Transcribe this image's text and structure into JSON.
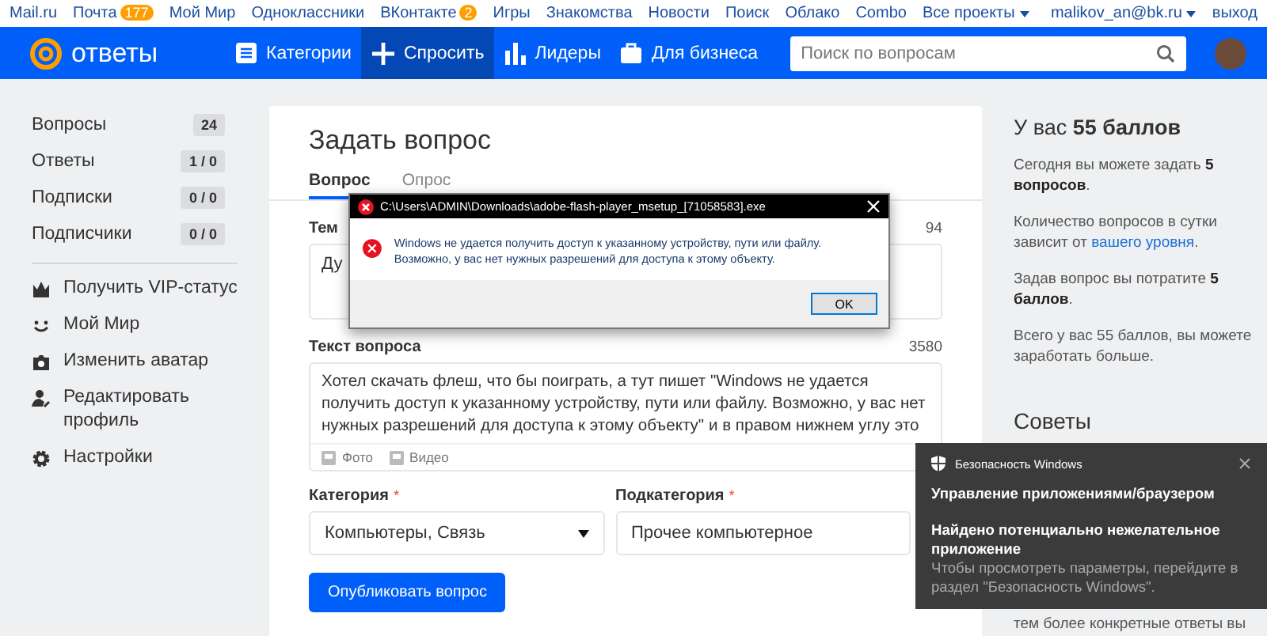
{
  "top_nav": {
    "items": [
      {
        "label": "Mail.ru"
      },
      {
        "label": "Почта",
        "badge": "177"
      },
      {
        "label": "Мой Мир"
      },
      {
        "label": "Одноклассники"
      },
      {
        "label": "ВКонтакте",
        "badge": "2"
      },
      {
        "label": "Игры"
      },
      {
        "label": "Знакомства"
      },
      {
        "label": "Новости"
      },
      {
        "label": "Поиск"
      },
      {
        "label": "Облако"
      },
      {
        "label": "Combo"
      }
    ],
    "projects": "Все проекты",
    "user": "malikov_an@bk.ru",
    "logout": "выход"
  },
  "header": {
    "logo": "ответы",
    "nav": [
      {
        "label": "Категории",
        "selected": false
      },
      {
        "label": "Спросить",
        "selected": true
      },
      {
        "label": "Лидеры",
        "selected": false
      },
      {
        "label": "Для бизнеса",
        "selected": false
      }
    ],
    "search": {
      "placeholder": "Поиск по вопросам"
    }
  },
  "sidebar": {
    "stats": [
      {
        "label": "Вопросы",
        "count": "24"
      },
      {
        "label": "Ответы",
        "count": "1 / 0"
      },
      {
        "label": "Подписки",
        "count": "0 / 0"
      },
      {
        "label": "Подписчики",
        "count": "0 / 0"
      }
    ],
    "links": [
      {
        "label": "Получить VIP-статус"
      },
      {
        "label": "Мой Мир"
      },
      {
        "label": "Изменить аватар"
      },
      {
        "label": "Редактировать профиль"
      },
      {
        "label": "Настройки"
      }
    ]
  },
  "main": {
    "title": "Задать вопрос",
    "tabs": [
      {
        "label": "Вопрос",
        "selected": true
      },
      {
        "label": "Опрос",
        "selected": false
      }
    ],
    "topic": {
      "label": "Тем",
      "counter": "94",
      "value": "Ду"
    },
    "question": {
      "label": "Текст вопроса",
      "counter": "3580",
      "value": "Хотел скачать флеш, что бы поиграть, а тут пишет \"Windows не удается получить доступ к указанному устройству, пути или файлу. Возможно, у вас нет нужных разрешений для доступа к этому объекту\" и в правом нижнем углу это",
      "attachments": [
        "Фото",
        "Видео"
      ]
    },
    "category": {
      "label": "Категория",
      "required_mark": "*",
      "value": "Компьютеры, Связь"
    },
    "subcategory": {
      "label": "Подкатегория",
      "required_mark": "*",
      "value": "Прочее компьютерное"
    },
    "submit": "Опубликовать вопрос"
  },
  "right": {
    "heading": "У вас **55 баллов**",
    "paragraphs": [
      {
        "text": "Сегодня вы можете задать **5 вопросов**."
      },
      {
        "text": "Количество вопросов в сутки зависит от ",
        "link": "вашего уровня",
        "after": "."
      },
      {
        "text": "Задав вопрос вы потратите **5 баллов**."
      },
      {
        "text": "Всего у вас 55 баллов, вы можете заработать больше."
      }
    ],
    "tips_heading": "Советы",
    "tips_cut": "тем более конкретные ответы вы"
  },
  "dialog": {
    "title": "C:\\Users\\ADMIN\\Downloads\\adobe-flash-player_msetup_[71058583].exe",
    "message": "Windows не удается получить доступ к указанному устройству, пути или файлу. Возможно, у вас нет нужных разрешений для доступа к этому объекту.",
    "button": "OK"
  },
  "toast": {
    "app": "Безопасность Windows",
    "heading": "Управление приложениями/браузером",
    "title": "Найдено потенциально нежелательное приложение",
    "body": "Чтобы просмотреть параметры, перейдите в раздел \"Безопасность Windows\"."
  }
}
